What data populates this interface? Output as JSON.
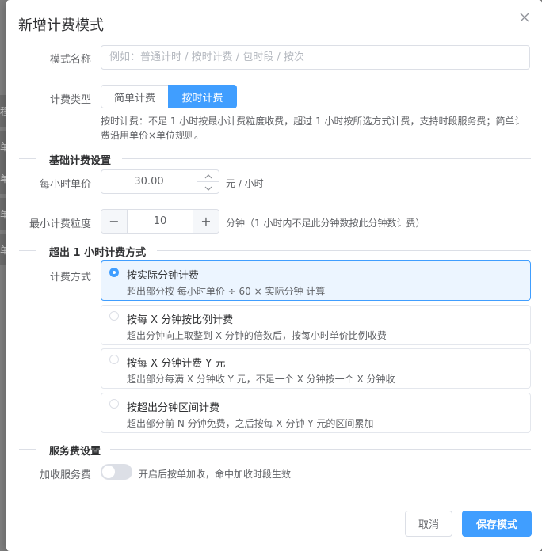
{
  "backdrop": {
    "fragments": [
      "程",
      "单",
      "单",
      "单",
      "单"
    ]
  },
  "dialog": {
    "title": "新增计费模式"
  },
  "form": {
    "name_label": "模式名称",
    "name_placeholder": "例如：普通计时 / 按时计费 / 包时段 / 按次",
    "name_value": "",
    "type_label": "计费类型",
    "type_options": [
      "简单计费",
      "按时计费"
    ],
    "type_selected": "按时计费",
    "type_hint": "按时计费：不足 1 小时按最小计费粒度收费，超过 1 小时按所选方式计费，支持时段服务费；简单计费沿用单价×单位规则。"
  },
  "basic": {
    "section_title": "基础计费设置",
    "price_label": "每小时单价",
    "price_value": "30.00",
    "price_unit": "元 / 小时",
    "granularity_label": "最小计费粒度",
    "granularity_value": "10",
    "granularity_unit": "分钟（1 小时内不足此分钟数按此分钟数计费）",
    "minus_symbol": "−",
    "plus_symbol": "+"
  },
  "overtime": {
    "section_title": "超出 1 小时计费方式",
    "method_label": "计费方式",
    "options": [
      {
        "title": "按实际分钟计费",
        "desc": "超出部分按 每小时单价 ÷ 60 × 实际分钟 计算",
        "selected": true
      },
      {
        "title": "按每 X 分钟按比例计费",
        "desc": "超出分钟向上取整到 X 分钟的倍数后，按每小时单价比例收费",
        "selected": false
      },
      {
        "title": "按每 X 分钟计费 Y 元",
        "desc": "超出部分每满 X 分钟收 Y 元，不足一个 X 分钟按一个 X 分钟收",
        "selected": false
      },
      {
        "title": "按超出分钟区间计费",
        "desc": "超出部分前 N 分钟免费，之后按每 X 分钟 Y 元的区间累加",
        "selected": false
      }
    ]
  },
  "service": {
    "section_title": "服务费设置",
    "fee_label": "加收服务费",
    "fee_enabled": false,
    "fee_hint": "开启后按单加收，命中加收时段生效"
  },
  "footer": {
    "cancel_label": "取消",
    "save_label": "保存模式"
  },
  "colors": {
    "primary": "#409eff",
    "primary_light": "#ecf5ff",
    "border": "#dcdfe6",
    "text": "#606266",
    "title": "#303133",
    "overlay": "#7f7f7f"
  }
}
